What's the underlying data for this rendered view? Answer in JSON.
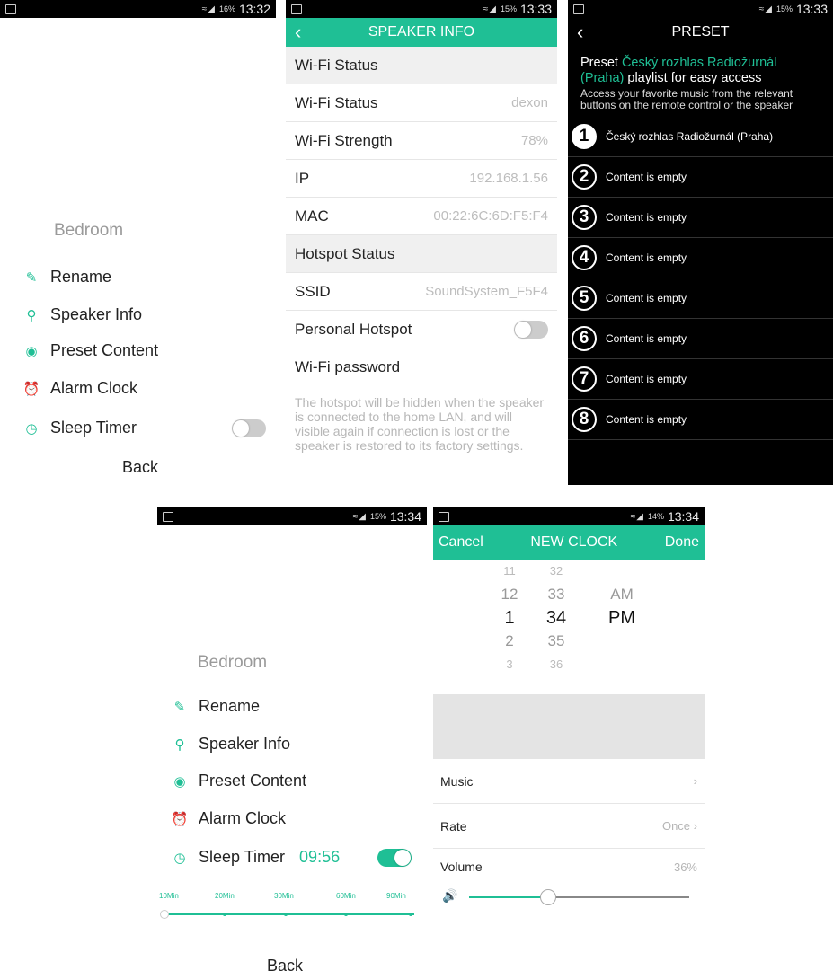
{
  "status": {
    "s1": {
      "battery": "16%",
      "time": "13:32"
    },
    "s2": {
      "battery": "15%",
      "time": "13:33"
    },
    "s3": {
      "battery": "15%",
      "time": "13:33"
    },
    "s4": {
      "battery": "15%",
      "time": "13:34"
    },
    "s5": {
      "battery": "14%",
      "time": "13:34"
    }
  },
  "menu": {
    "room": "Bedroom",
    "items": [
      "Rename",
      "Speaker Info",
      "Preset Content",
      "Alarm Clock",
      "Sleep Timer"
    ],
    "back": "Back"
  },
  "menu2": {
    "sleep_value": "09:56",
    "timer_options": [
      "10Min",
      "20Min",
      "30Min",
      "60Min",
      "90Min"
    ]
  },
  "speaker_info": {
    "title": "SPEAKER INFO",
    "wifi_header": "Wi-Fi Status",
    "rows": [
      {
        "label": "Wi-Fi Status",
        "value": "dexon"
      },
      {
        "label": "Wi-Fi Strength",
        "value": "78%"
      },
      {
        "label": "IP",
        "value": "192.168.1.56"
      },
      {
        "label": "MAC",
        "value": "00:22:6C:6D:F5:F4"
      }
    ],
    "hotspot_header": "Hotspot Status",
    "ssid_label": "SSID",
    "ssid_value": "SoundSystem_F5F4",
    "personal_hotspot": "Personal Hotspot",
    "wifi_password": "Wi-Fi password",
    "note": "The hotspot will be hidden when the speaker is connected to the home LAN, and will visible again if connection is lost or the speaker is restored to its factory settings."
  },
  "preset": {
    "title": "PRESET",
    "intro_word": "Preset",
    "station": "Český rozhlas Radiožurnál (Praha)",
    "intro_rest": "playlist for easy access",
    "sub": "Access your favorite music from the relevant buttons on the remote control or the speaker",
    "rows": [
      {
        "num": "1",
        "text": "Český rozhlas Radiožurnál (Praha)"
      },
      {
        "num": "2",
        "text": "Content is empty"
      },
      {
        "num": "3",
        "text": "Content is empty"
      },
      {
        "num": "4",
        "text": "Content is empty"
      },
      {
        "num": "5",
        "text": "Content is empty"
      },
      {
        "num": "6",
        "text": "Content is empty"
      },
      {
        "num": "7",
        "text": "Content is empty"
      },
      {
        "num": "8",
        "text": "Content is empty"
      }
    ]
  },
  "clock": {
    "cancel": "Cancel",
    "title": "NEW CLOCK",
    "done": "Done",
    "hours": [
      "11",
      "12",
      "1",
      "2",
      "3"
    ],
    "minutes": [
      "32",
      "33",
      "34",
      "35",
      "36"
    ],
    "ampm": [
      "AM",
      "PM"
    ],
    "music": "Music",
    "rate_label": "Rate",
    "rate_value": "Once",
    "volume_label": "Volume",
    "volume_value": "36%",
    "volume_level": 0.36
  },
  "icons": {
    "back": "chevron-left-icon",
    "arrow": "chevron-right-icon"
  }
}
